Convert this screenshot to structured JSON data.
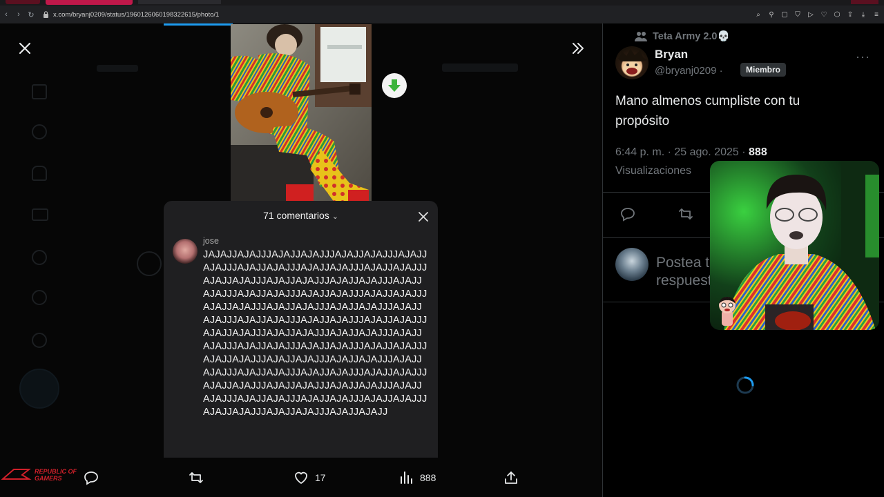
{
  "browser": {
    "url": "x.com/bryanj0209/status/1960126060198322615/photo/1"
  },
  "viewer": {
    "close_label": "Close",
    "expand_label": "Expand"
  },
  "comments": {
    "header": "71 comentarios",
    "username": "jose",
    "text": "JAJAJJAJAJJJAJAJJAJAJJJAJAJJAJAJJJAJAJJAJAJJJAJAJJAJAJJJAJAJJAJAJJJAJAJJAJAJJJAJAJJAJAJJJAJAJJAJAJJJAJAJJAJAJJJAJAJJAJAJJJAJAJJAJAJJJAJAJJAJAJJJAJAJJAJAJJJAJAJJAJAJJJAJAJJAJAJJJAJAJJAJAJJJAJAJJAJAJJJAJAJJAJAJJJAJAJJAJAJJJAJAJJAJAJJJAJAJJAJAJJJAJAJJAJAJJJAJAJJAJAJJJAJAJJAJAJJJAJAJJAJAJJJAJAJJAJAJJJAJAJJAJAJJJAJAJJAJAJJJAJAJJAJAJJJAJAJJAJAJJJAJAJJAJAJJJAJAJJAJAJJJAJAJJAJAJJJAJAJJAJAJJJAJAJJAJAJJJAJAJJAJAJJJAJAJJAJAJJJAJAJJAJAJJJAJAJJAJAJJJAJAJJAJAJJJAJAJJAJAJJJAJAJJAJAJJJAJAJJAJAJJJAJAJJAJAJJ"
  },
  "action_bar": {
    "likes": "17",
    "views": "888"
  },
  "tweet": {
    "community": "Teta Army 2.0💀",
    "display_name": "Bryan",
    "handle": "@bryanj0209 ·",
    "badge": "Miembro",
    "more": "···",
    "text": "Mano almenos cumpliste con tu propósito",
    "timestamp": "6:44 p. m. · 25 ago. 2025 ·",
    "views_count": "888",
    "views_label": "Visualizaciones",
    "reply_placeholder": "Postea tu respuesta"
  },
  "colors": {
    "accent": "#1d9bf0",
    "background": "#000000",
    "muted": "#71767b",
    "download_green": "#3cb43c"
  }
}
